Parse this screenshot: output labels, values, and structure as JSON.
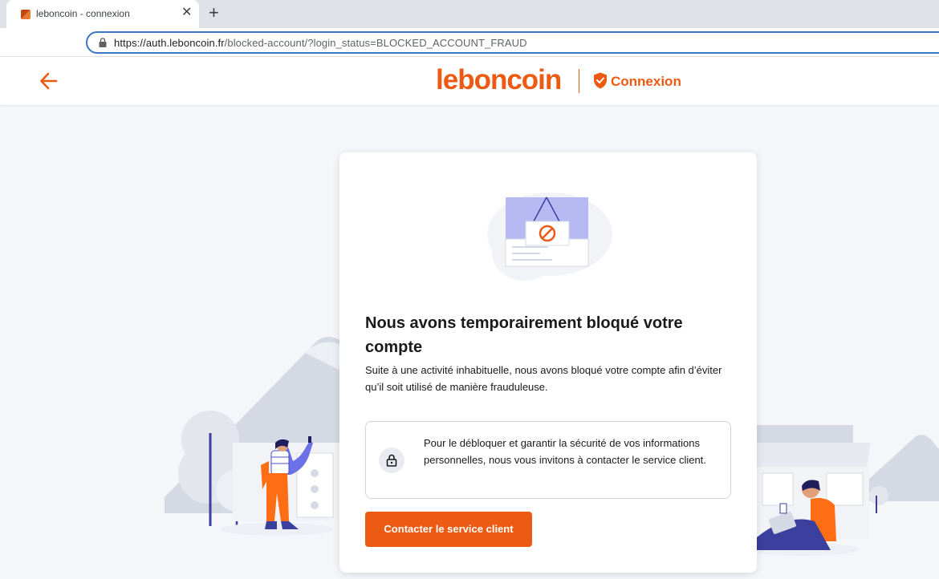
{
  "browser": {
    "tab_title": "leboncoin - connexion",
    "tab_close": "✕",
    "new_tab": "+",
    "url_main": "https://auth.leboncoin.fr",
    "url_rest": "/blocked-account/?login_status=BLOCKED_ACCOUNT_FRAUD"
  },
  "header": {
    "logo_text": "leboncoin",
    "section_label": "Connexion",
    "back_icon": "arrow-left-icon",
    "section_icon": "shield-check-icon"
  },
  "card": {
    "title": "Nous avons temporairement bloqué votre compte",
    "description": "Suite à une activité inhabituelle, nous avons bloqué votre compte afin d’éviter qu’il soit utilisé de manière frauduleuse.",
    "info_text": "Pour le débloquer et garantir la sécurité de vos informations personnelles, nous vous invitons à contacter le service client.",
    "info_icon": "lock-icon",
    "cta_label": "Contacter le service client"
  },
  "colors": {
    "brand": "#ec5a13",
    "background": "#f4f6fa",
    "illustration_grey": "#d5d9e3",
    "illustration_blue": "#4b4fc8"
  }
}
